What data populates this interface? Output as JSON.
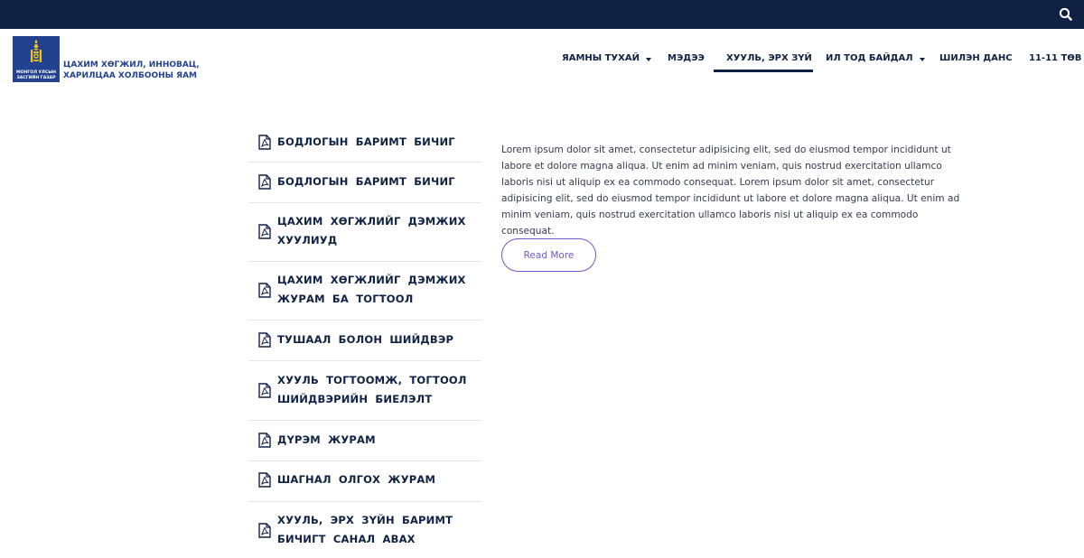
{
  "header": {
    "ministry_line1": "ЦАХИМ ХӨГЖИЛ, ИННОВАЦ,",
    "ministry_line2": "ХАРИЛЦАА ХОЛБООНЫ ЯАМ",
    "emblem_line1": "МОНГОЛ УЛСЫН",
    "emblem_line2": "ЗАСГИЙН ГАЗАР",
    "search_icon": "search-icon",
    "brand_color": "#22418f",
    "topbar_color": "#0f2244"
  },
  "nav": [
    {
      "label": "ЯАМНЫ ТУХАЙ",
      "dropdown": true
    },
    {
      "label": "МЭДЭЭ",
      "dropdown": false
    },
    {
      "label": "ХУУЛЬ, ЭРХ ЗҮЙ",
      "dropdown": false,
      "active": true
    },
    {
      "label": "ИЛ ТОД БАЙДАЛ",
      "dropdown": true
    },
    {
      "label": "ШИЛЭН ДАНС",
      "dropdown": false
    },
    {
      "label": "11-11 ТӨВ",
      "dropdown": false
    }
  ],
  "documents": [
    {
      "line1": "БОДЛОГЫН БАРИМТ БИЧИГ",
      "line2": ""
    },
    {
      "line1": "БОДЛОГЫН БАРИМТ БИЧИГ",
      "line2": ""
    },
    {
      "line1": "ЦАХИМ ХӨГЖЛИЙГ ДЭМЖИХ",
      "line2": "ХУУЛИУД"
    },
    {
      "line1": "ЦАХИМ ХӨГЖЛИЙГ ДЭМЖИХ",
      "line2": "ЖУРАМ БА ТОГТООЛ"
    },
    {
      "line1": "ТУШААЛ БОЛОН ШИЙДВЭР",
      "line2": ""
    },
    {
      "line1": "ХУУЛЬ ТОГТООМЖ, ТОГТООЛ",
      "line2": "ШИЙДВЭРИЙН БИЕЛЭЛТ"
    },
    {
      "line1": "ДҮРЭМ ЖУРАМ",
      "line2": ""
    },
    {
      "line1": "ШАГНАЛ ОЛГОХ ЖУРАМ",
      "line2": ""
    },
    {
      "line1": "ХУУЛЬ, ЭРХ ЗҮЙН БАРИМТ",
      "line2": "БИЧИГТ САНАЛ АВАХ"
    }
  ],
  "content": {
    "paragraph": "Lorem ipsum dolor sit amet, consectetur adipisicing elit, sed do eiusmod tempor incididunt ut labore et dolore magna aliqua. Ut enim ad minim veniam, quis nostrud exercitation ullamco laboris nisi ut aliquip ex ea commodo consequat. Lorem ipsum dolor sit amet, consectetur adipisicing elit, sed do eiusmod tempor incididunt ut labore et dolore magna aliqua. Ut enim ad minim veniam, quis nostrud exercitation ullamco laboris nisi ut aliquip ex ea commodo consequat.",
    "read_more": "Read More",
    "accent_color": "#6c58c8"
  }
}
